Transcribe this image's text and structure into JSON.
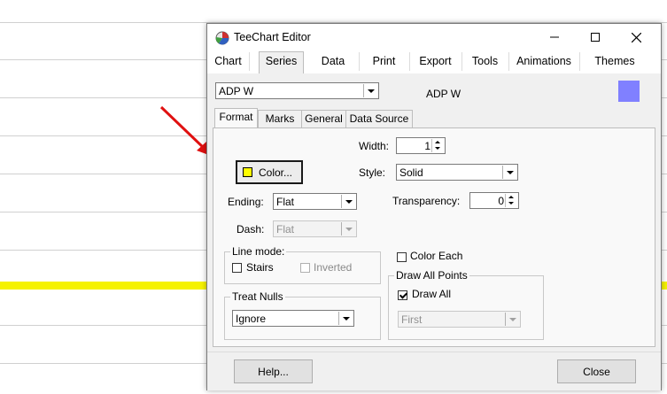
{
  "window": {
    "title": "TeeChart Editor",
    "controls": {
      "minimize": "—",
      "maximize": "☐",
      "close": "✕"
    }
  },
  "main_tabs": [
    "Chart",
    "Series",
    "Data",
    "Print",
    "Export",
    "Tools",
    "Animations",
    "Themes"
  ],
  "active_main_tab": "Series",
  "series_selector": {
    "value": "ADP W"
  },
  "series_label": "ADP W",
  "series_color": "#8080ff",
  "sub_tabs": [
    "Format",
    "Marks",
    "General",
    "Data Source"
  ],
  "active_sub_tab": "Format",
  "format": {
    "color_button": "Color...",
    "color_swatch": "#ffff00",
    "width_label": "Width:",
    "width_value": "1",
    "style_label": "Style:",
    "style_value": "Solid",
    "ending_label": "Ending:",
    "ending_value": "Flat",
    "transparency_label": "Transparency:",
    "transparency_value": "0",
    "dash_label": "Dash:",
    "dash_value": "Flat",
    "line_mode_title": "Line mode:",
    "stairs_label": "Stairs",
    "inverted_label": "Inverted",
    "color_each_label": "Color Each",
    "treat_nulls_title": "Treat Nulls",
    "treat_nulls_value": "Ignore",
    "draw_all_points_title": "Draw All Points",
    "draw_all_label": "Draw All",
    "draw_all_checked": true,
    "draw_all_mode_value": "First"
  },
  "buttons": {
    "help": "Help...",
    "close": "Close"
  },
  "background_series_color": "#f5f200"
}
